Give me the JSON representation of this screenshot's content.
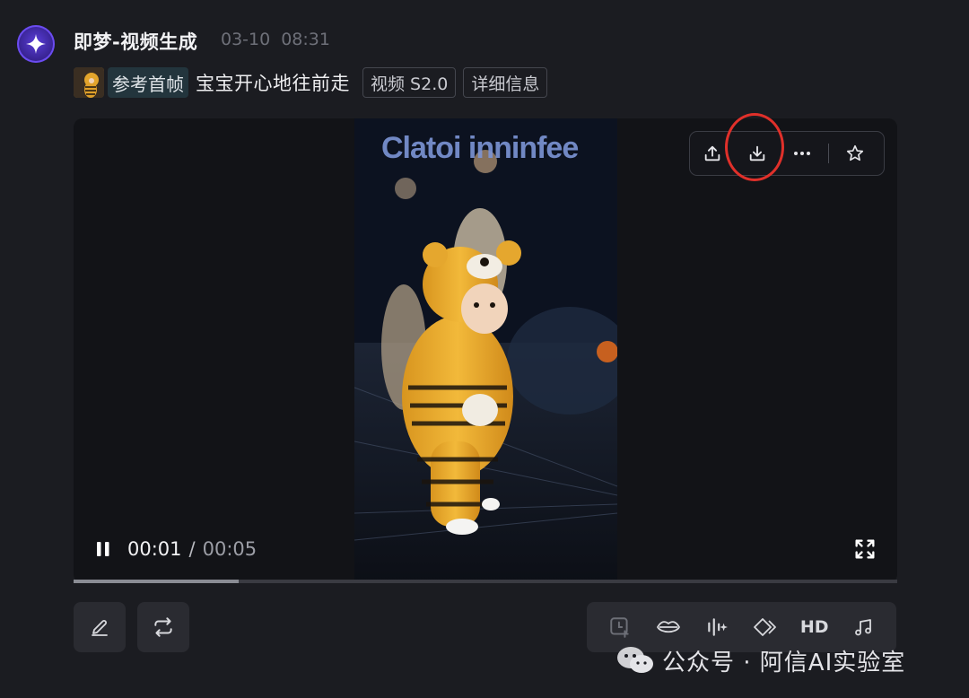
{
  "message": {
    "sender": "即梦-视频生成",
    "date": "03-10",
    "time": "08:31"
  },
  "prompt": {
    "ref_label": "参考首帧",
    "text": "宝宝开心地往前走",
    "chips": [
      "视频 S2.0",
      "详细信息"
    ]
  },
  "video": {
    "current_time": "00:01",
    "separator": "/",
    "duration": "00:05",
    "progress_fraction": 0.2,
    "frame_sign_text": "Clatoi inninfee",
    "state": "playing"
  },
  "toolbar": {
    "icons": [
      "upload-icon",
      "download-icon",
      "more-icon",
      "star-icon"
    ]
  },
  "actions": {
    "left": [
      "edit-icon",
      "regenerate-icon"
    ],
    "right": [
      "add-frame-icon",
      "lip-sync-icon",
      "audio-wave-icon",
      "interpolate-icon",
      "hd-label",
      "music-icon"
    ],
    "hd_label": "HD"
  },
  "watermark": {
    "text": "公众号 · 阿信AI实验室"
  },
  "colors": {
    "background": "#1b1c21",
    "accent": "#5a3dd8",
    "highlight": "#e0302a"
  }
}
